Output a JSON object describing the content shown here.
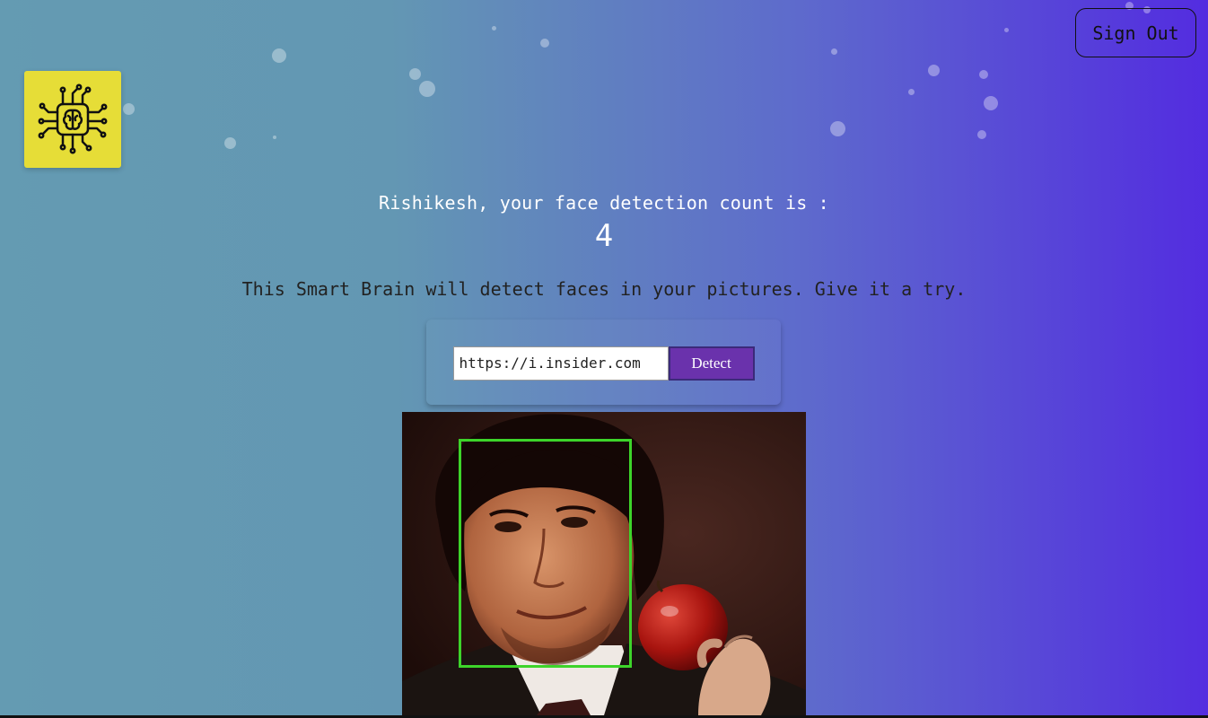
{
  "navigation": {
    "sign_out_label": "Sign Out"
  },
  "logo": {
    "icon": "brain-circuit-icon",
    "background_color": "#e6dd37"
  },
  "rank": {
    "message": "Rishikesh, your face detection count is :",
    "count": "4"
  },
  "image_link_form": {
    "instructions": "This Smart Brain will detect faces in your pictures. Give it a try.",
    "input_value": "https://i.insider.com",
    "detect_label": "Detect"
  },
  "face_recognition": {
    "box_color": "#3dd42a"
  },
  "colors": {
    "gradient_start": "#649bb2",
    "gradient_end": "#532ce0",
    "button_color": "#6a32ac"
  }
}
